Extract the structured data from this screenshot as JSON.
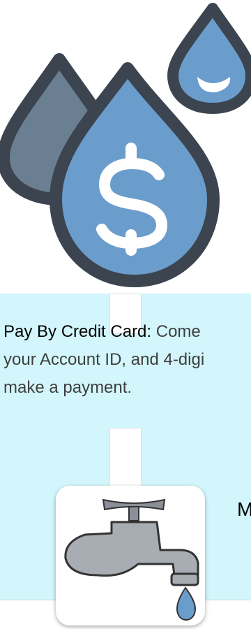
{
  "hero": {
    "icon": "water-drops-dollar-icon"
  },
  "payment": {
    "heading": "Pay By Credit Card:",
    "body": " Come\nyour Account ID, and 4-digi\nmake a payment."
  },
  "more": {
    "label": "M"
  },
  "faucet": {
    "icon": "faucet-icon"
  },
  "colors": {
    "panel_bg": "#d2f6fb",
    "drop_fill": "#6b9dcc",
    "drop_dark": "#6a7f93",
    "drop_outline": "#3c4450"
  }
}
